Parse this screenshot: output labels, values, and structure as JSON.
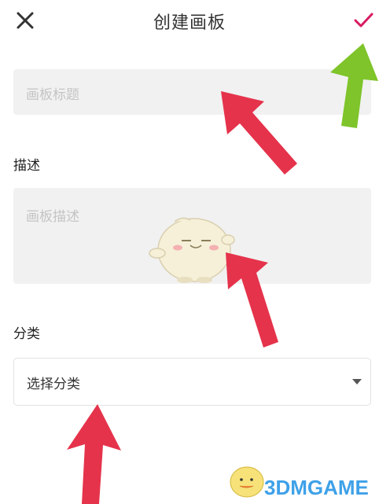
{
  "header": {
    "title": "创建画板"
  },
  "form": {
    "title_placeholder": "画板标题",
    "desc_label": "描述",
    "desc_placeholder": "画板描述",
    "category_label": "分类",
    "category_value": "选择分类"
  },
  "watermark": {
    "text": "3DMGAME"
  },
  "colors": {
    "accent": "#d81b60",
    "arrow_red": "#e5334b",
    "arrow_green": "#7ec42a",
    "input_bg": "#f1f1f1"
  }
}
